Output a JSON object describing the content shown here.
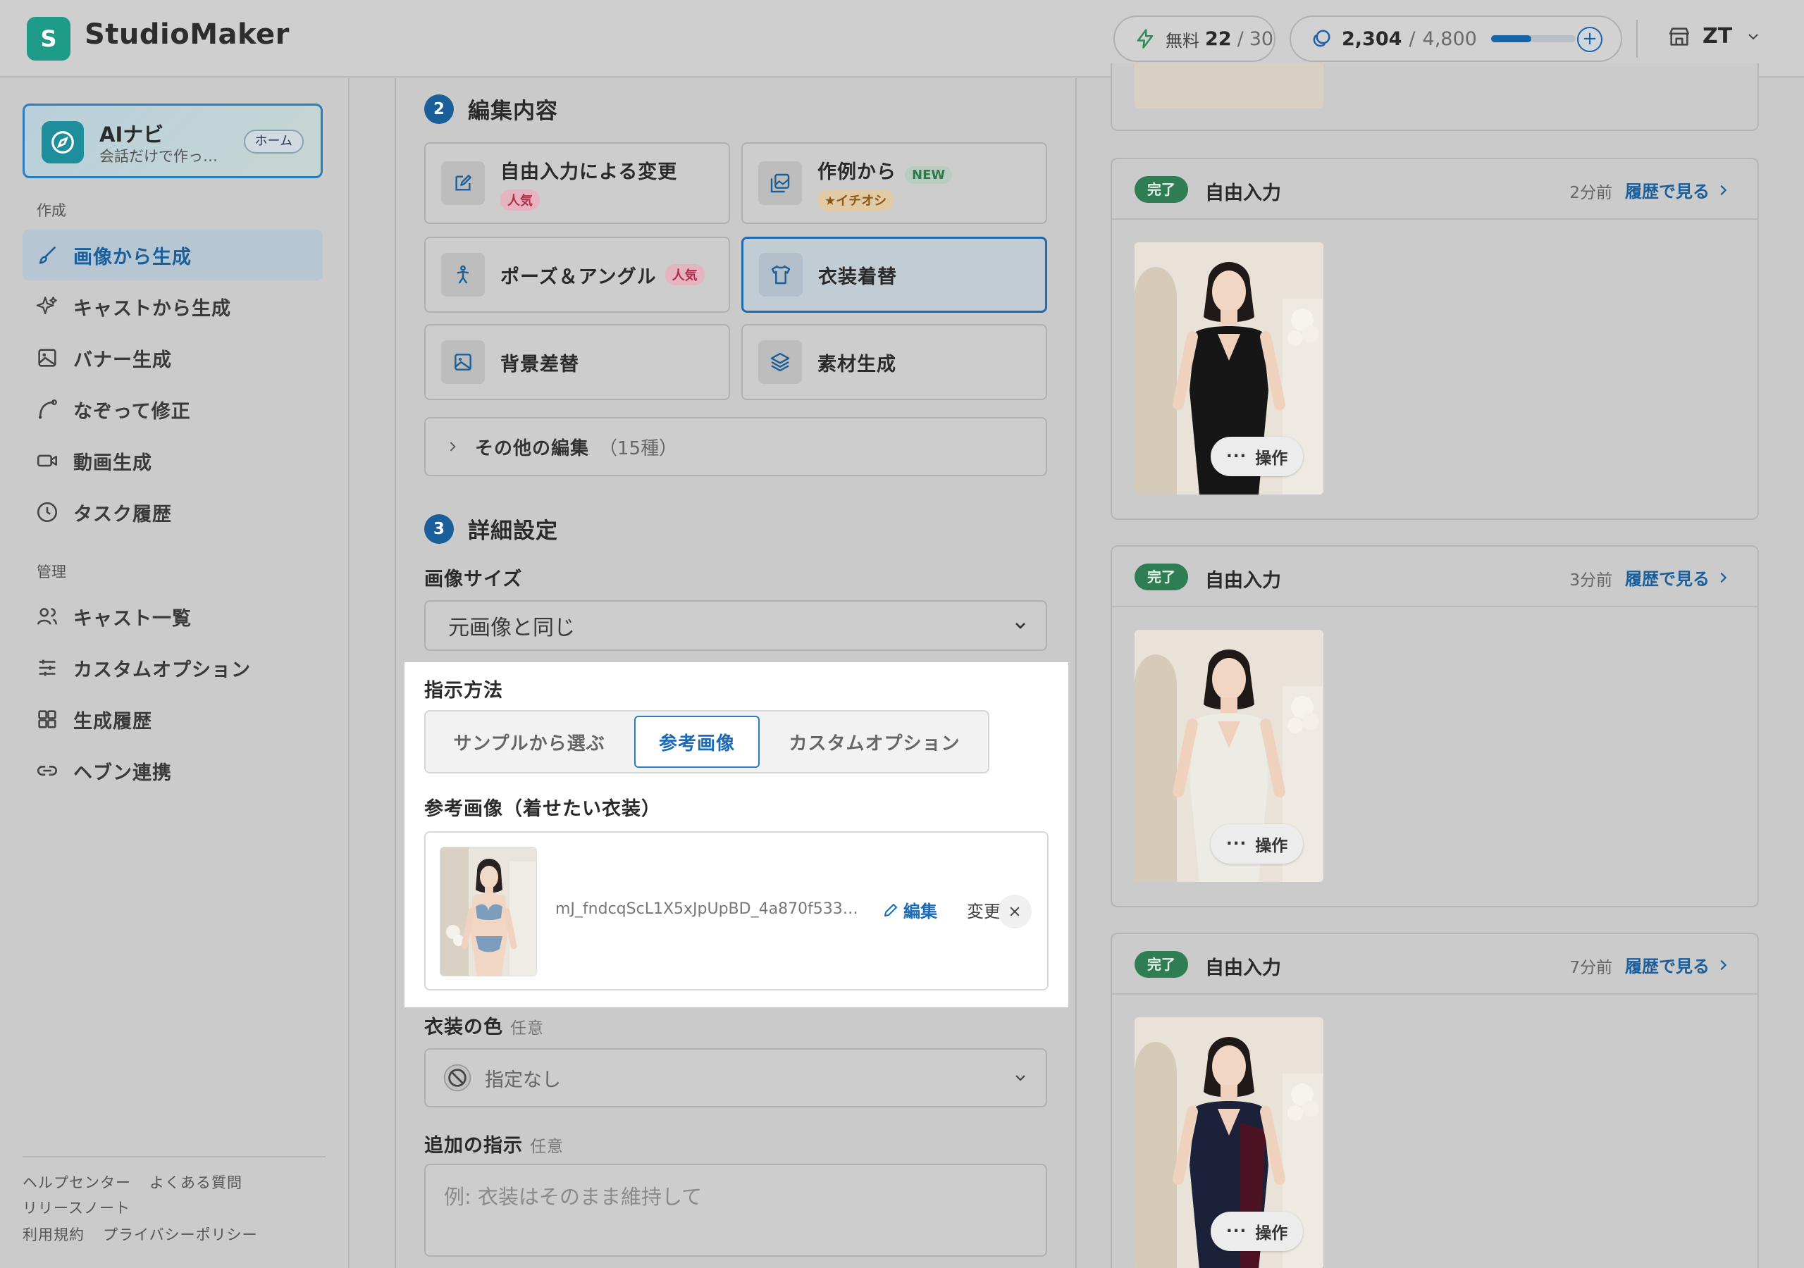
{
  "header": {
    "logo_letter": "S",
    "brand": "StudioMaker",
    "free": {
      "label": "無料",
      "used": "22",
      "sep": "/",
      "total": "30"
    },
    "credits": {
      "current": "2,304",
      "sep": "/",
      "max": "4,800",
      "fraction": 0.48
    },
    "plus_label": "+",
    "user_initials": "ZT"
  },
  "sidebar": {
    "ai_card": {
      "title": "AIナビ",
      "subtitle": "会話だけで作っ…",
      "home": "ホーム"
    },
    "section_create": "作成",
    "section_manage": "管理",
    "create_items": [
      {
        "label": "画像から生成",
        "icon": "brush-icon"
      },
      {
        "label": "キャストから生成",
        "icon": "sparkle-icon"
      },
      {
        "label": "バナー生成",
        "icon": "image-icon"
      },
      {
        "label": "なぞって修正",
        "icon": "trace-icon"
      },
      {
        "label": "動画生成",
        "icon": "video-icon"
      },
      {
        "label": "タスク履歴",
        "icon": "clock-icon"
      }
    ],
    "manage_items": [
      {
        "label": "キャスト一覧",
        "icon": "users-icon"
      },
      {
        "label": "カスタムオプション",
        "icon": "sliders-icon"
      },
      {
        "label": "生成履歴",
        "icon": "grid-icon"
      },
      {
        "label": "ヘブン連携",
        "icon": "link-icon"
      }
    ],
    "footer": {
      "help": "ヘルプセンター",
      "faq": "よくある質問",
      "release": "リリースノート",
      "terms": "利用規約",
      "privacy": "プライバシーポリシー"
    }
  },
  "form": {
    "step2": {
      "num": "2",
      "title": "編集内容"
    },
    "options": [
      {
        "title": "自由入力による変更",
        "badge": "人気"
      },
      {
        "title": "作例から",
        "badge_new": "NEW",
        "badge_rec": "★イチオシ"
      },
      {
        "title": "ポーズ＆アングル",
        "badge": "人気"
      },
      {
        "title": "衣装着替"
      },
      {
        "title": "背景差替"
      },
      {
        "title": "素材生成"
      }
    ],
    "more": {
      "label": "その他の編集",
      "count": "（15種）"
    },
    "step3": {
      "num": "3",
      "title": "詳細設定"
    },
    "image_size": {
      "label": "画像サイズ",
      "value": "元画像と同じ"
    },
    "instruction": {
      "label": "指示方法",
      "tabs": [
        "サンプルから選ぶ",
        "参考画像",
        "カスタムオプション"
      ],
      "active_index": 1
    },
    "reference": {
      "label": "参考画像（着せたい衣装）",
      "filename": "mJ_fndcqScL1X5xJpUpBD_4a870f533…",
      "edit": "編集",
      "change": "変更"
    },
    "color": {
      "label": "衣装の色",
      "optional": "任意",
      "value": "指定なし"
    },
    "extra": {
      "label": "追加の指示",
      "optional": "任意",
      "placeholder": "例: 衣装はそのまま維持して"
    }
  },
  "results": {
    "done": "完了",
    "view_history": "履歴で見る",
    "action": "操作",
    "action_dots": "···",
    "items": [
      {
        "title": "自由入力",
        "time": "2分前",
        "dress_color": "#161616"
      },
      {
        "title": "自由入力",
        "time": "3分前",
        "dress_color": "#ecebe4"
      },
      {
        "title": "自由入力",
        "time": "7分前",
        "dress_color": "#1b2138"
      }
    ]
  }
}
